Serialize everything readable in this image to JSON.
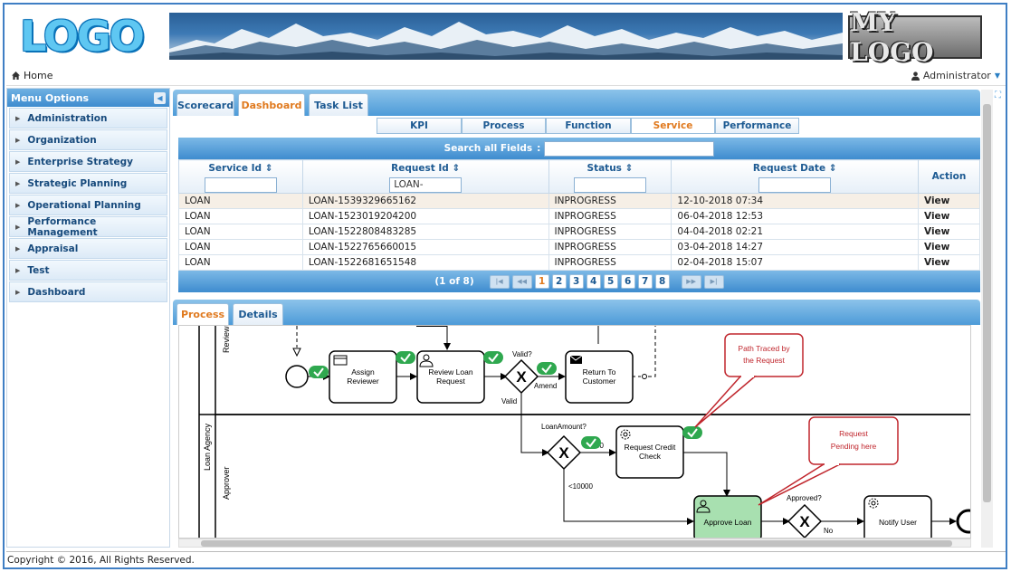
{
  "header": {
    "logo_left": "LOGO",
    "logo_right": "MY LOGO"
  },
  "topbar": {
    "home_label": "Home",
    "user_label": "Administrator"
  },
  "sidebar": {
    "title": "Menu Options",
    "items": [
      "Administration",
      "Organization",
      "Enterprise Strategy",
      "Strategic Planning",
      "Operational Planning",
      "Performance Management",
      "Appraisal",
      "Test",
      "Dashboard"
    ]
  },
  "tabs": {
    "items": [
      "Scorecard",
      "Dashboard",
      "Task List"
    ],
    "active": "Dashboard"
  },
  "subtabs": {
    "items": [
      "KPI",
      "Process",
      "Function",
      "Service",
      "Performance"
    ],
    "active": "Service"
  },
  "grid": {
    "search_label": "Search all Fields",
    "columns": [
      "Service Id",
      "Request Id",
      "Status",
      "Request Date",
      "Action"
    ],
    "filter_request_id": "LOAN-",
    "rows": [
      [
        "LOAN",
        "LOAN-1539329665162",
        "INPROGRESS",
        "12-10-2018 07:34",
        "View"
      ],
      [
        "LOAN",
        "LOAN-1523019204200",
        "INPROGRESS",
        "06-04-2018 12:53",
        "View"
      ],
      [
        "LOAN",
        "LOAN-1522808483285",
        "INPROGRESS",
        "04-04-2018 02:21",
        "View"
      ],
      [
        "LOAN",
        "LOAN-1522765660015",
        "INPROGRESS",
        "03-04-2018 14:27",
        "View"
      ],
      [
        "LOAN",
        "LOAN-1522681651548",
        "INPROGRESS",
        "02-04-2018 15:07",
        "View"
      ]
    ],
    "pager_text": "(1 of 8)",
    "pages": [
      "1",
      "2",
      "3",
      "4",
      "5",
      "6",
      "7",
      "8"
    ],
    "current_page": "1"
  },
  "detail_tabs": {
    "items": [
      "Process",
      "Details"
    ],
    "active": "Process"
  },
  "diagram": {
    "lanes": [
      "Reviewer",
      "Loan Agency",
      "Approver"
    ],
    "tasks": {
      "assign": "Assign Reviewer",
      "review": "Review Loan Request",
      "return": "Return To Customer",
      "credit": "Request Credit Check",
      "approve": "Approve Loan",
      "notify": "Notify User"
    },
    "gateway_labels": {
      "valid_q": "Valid?",
      "amend": "Amend",
      "valid": "Valid",
      "amount_q": "LoanAmount?",
      "over": "00",
      "under": "<10000",
      "approved_q": "Approved?",
      "no": "No"
    },
    "callouts": {
      "path": "Path Traced by the Request",
      "pending": "Request Pending here"
    }
  },
  "footer": {
    "copyright": "Copyright © 2016, All Rights Reserved."
  },
  "colors": {
    "accent": "#3e8ccf",
    "active_tab": "#e07a1f",
    "callout": "#c0262d",
    "done": "#2fa84f",
    "pending_task": "#a8e0b0"
  }
}
